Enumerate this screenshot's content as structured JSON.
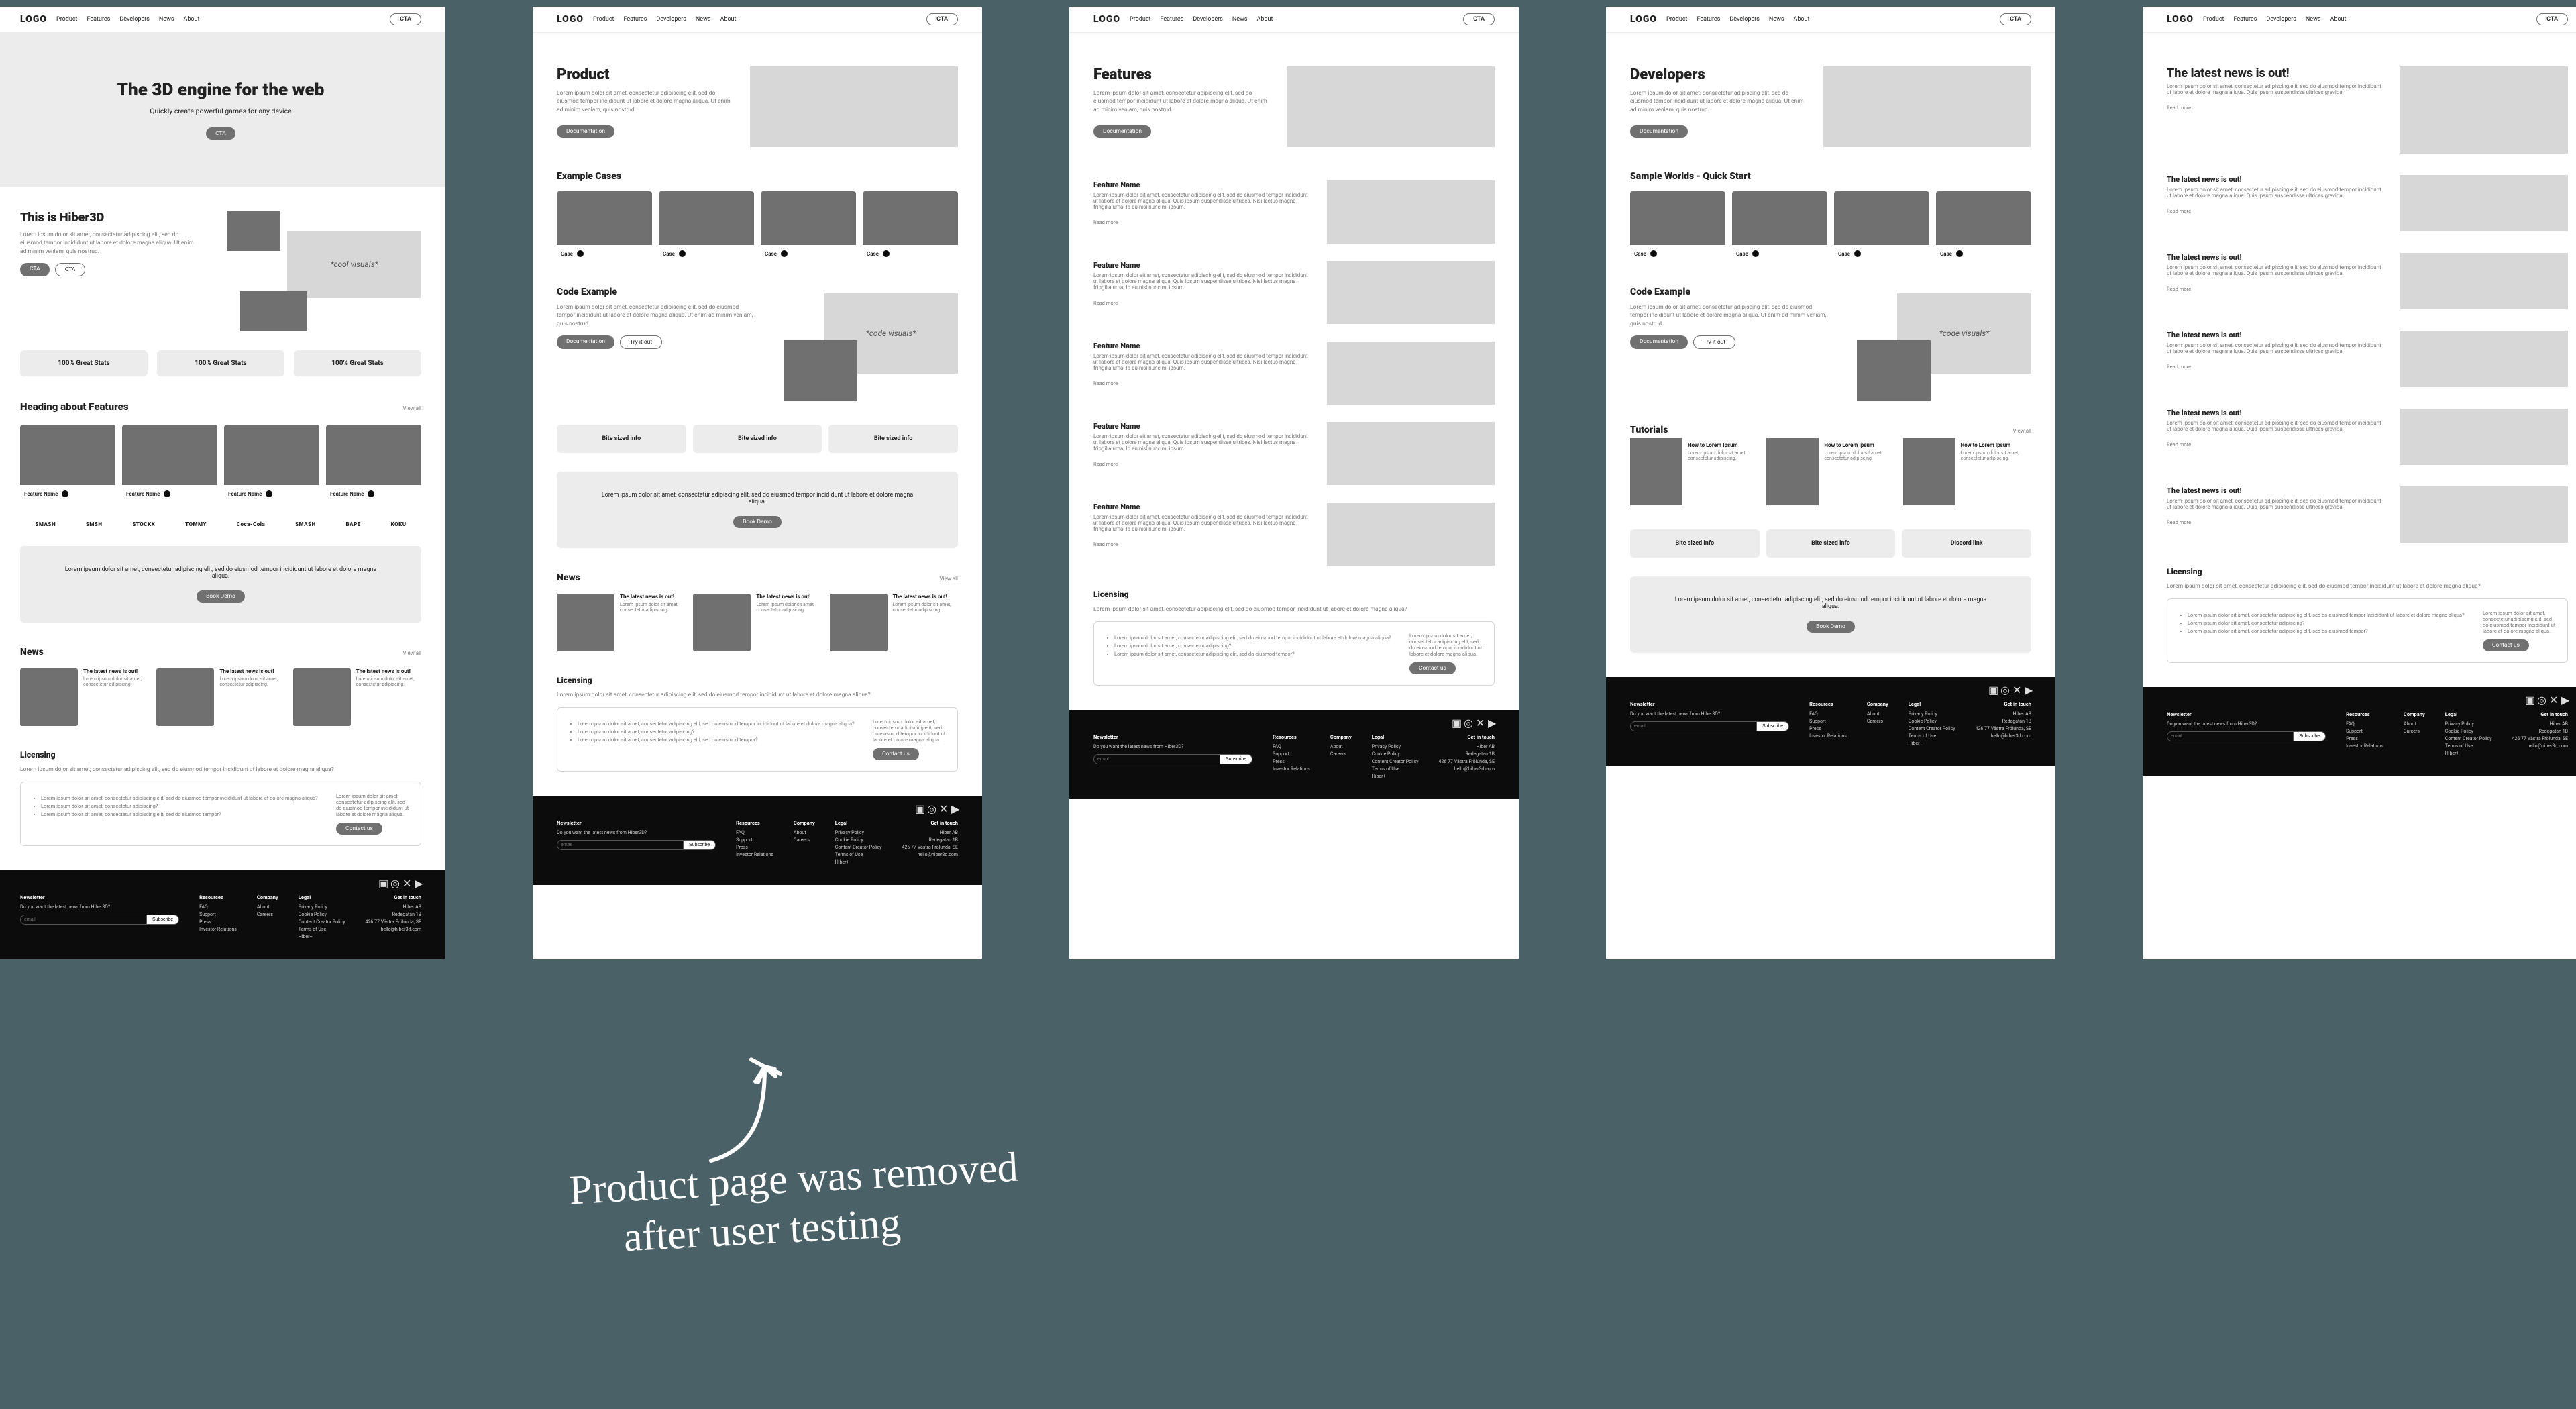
{
  "meta": {
    "domain": "Document"
  },
  "nav": {
    "logo": "LOGO",
    "items": [
      "Product",
      "Features",
      "Developers",
      "News",
      "About"
    ],
    "cta": "CTA"
  },
  "home": {
    "hero_title": "The 3D engine for the web",
    "hero_sub": "Quickly create powerful games for any device",
    "hero_cta": "CTA",
    "hiber_title": "This is Hiber3D",
    "hiber_copy": "Lorem ipsum dolor sit amet, consectetur adipiscing elit, sed do eiusmod tempor incididunt ut labore et dolore magna aliqua. Ut enim ad minim veniam, quis nostrud.",
    "hiber_cta1": "CTA",
    "hiber_cta2": "CTA",
    "hiber_visual": "*cool visuals*",
    "stats": [
      "100% Great Stats",
      "100% Great Stats",
      "100% Great Stats"
    ],
    "features_heading": "Heading about Features",
    "view_all": "View all",
    "feature_cards": [
      {
        "label": "Feature Name"
      },
      {
        "label": "Feature Name"
      },
      {
        "label": "Feature Name"
      },
      {
        "label": "Feature Name"
      }
    ],
    "partners": [
      "SMASH",
      "SMSH",
      "STOCKX",
      "TOMMY",
      "Coca-Cola",
      "SMASH",
      "BAPE",
      "KOKU"
    ],
    "banner_copy": "Lorem ipsum dolor sit amet, consectetur adipiscing elit, sed do eiusmod tempor incididunt ut labore et dolore magna aliqua.",
    "banner_cta": "Book Demo",
    "news_heading": "News",
    "news_items": [
      {
        "title": "The latest news is out!",
        "copy": "Lorem ipsum dolor sit amet, consectetur adipiscing."
      },
      {
        "title": "The latest news is out!",
        "copy": "Lorem ipsum dolor sit amet, consectetur adipiscing."
      },
      {
        "title": "The latest news is out!",
        "copy": "Lorem ipsum dolor sit amet, consectetur adipiscing."
      }
    ],
    "licensing_heading": "Licensing",
    "licensing_intro": "Lorem ipsum dolor sit amet, consectetur adipiscing elit, sed do eiusmod tempor incididunt ut labore et dolore magna aliqua?",
    "licensing_bullets": [
      "Lorem ipsum dolor sit amet, consectetur adipiscing elit, sed do eiusmod tempor incididunt ut labore et dolore magna aliqua?",
      "Lorem ipsum dolor sit amet, consectetur adipiscing?",
      "Lorem ipsum dolor sit amet, consectetur adipiscing elit, sed do eiusmod tempor?"
    ],
    "lic_right_copy": "Lorem ipsum dolor sit amet, consectetur adipiscing elit, sed do eiusmod tempor incididunt ut labore et dolore magna aliqua.",
    "contact_btn": "Contact us"
  },
  "product": {
    "title": "Product",
    "intro": "Lorem ipsum dolor sit amet, consectetur adipiscing elit, sed do eiusmod tempor incididunt ut labore et dolore magna aliqua. Ut enim ad minim veniam, quis nostrud.",
    "doc_btn": "Documentation",
    "examples_heading": "Example Cases",
    "case_label": "Case",
    "code_heading": "Code Example",
    "code_copy": "Lorem ipsum dolor sit amet, consectetur adipiscing elit, sed do eiusmod tempor incididunt ut labore et dolore magna aliqua. Ut enim ad minim veniam, quis nostrud.",
    "code_visual": "*code visuals*",
    "code_btn1": "Documentation",
    "code_btn2": "Try it out",
    "bites": [
      "Bite sized info",
      "Bite sized info",
      "Bite sized info"
    ],
    "book_demo": "Book Demo",
    "news_heading": "News",
    "licensing_heading": "Licensing",
    "view_all": "View all"
  },
  "features": {
    "title": "Features",
    "intro": "Lorem ipsum dolor sit amet, consectetur adipiscing elit, sed do eiusmod tempor incididunt ut labore et dolore magna aliqua. Ut enim ad minim veniam, quis nostrud.",
    "doc_btn": "Documentation",
    "items": [
      {
        "title": "Feature Name",
        "copy": "Lorem ipsum dolor sit amet, consectetur adipiscing elit, sed do eiusmod tempor incididunt ut labore et dolore magna aliqua. Quis ipsum suspendisse ultrices. Nisi lectus magna fringilla urna. Id eu nisl nunc mi ipsum.",
        "more": "Read more"
      },
      {
        "title": "Feature Name",
        "copy": "Lorem ipsum dolor sit amet, consectetur adipiscing elit, sed do eiusmod tempor incididunt ut labore et dolore magna aliqua. Quis ipsum suspendisse ultrices. Nisi lectus magna fringilla urna. Id eu nisl nunc mi ipsum.",
        "more": "Read more"
      },
      {
        "title": "Feature Name",
        "copy": "Lorem ipsum dolor sit amet, consectetur adipiscing elit, sed do eiusmod tempor incididunt ut labore et dolore magna aliqua. Quis ipsum suspendisse ultrices. Nisi lectus magna fringilla urna. Id eu nisl nunc mi ipsum.",
        "more": "Read more"
      },
      {
        "title": "Feature Name",
        "copy": "Lorem ipsum dolor sit amet, consectetur adipiscing elit, sed do eiusmod tempor incididunt ut labore et dolore magna aliqua. Quis ipsum suspendisse ultrices. Nisi lectus magna fringilla urna. Id eu nisl nunc mi ipsum.",
        "more": "Read more"
      },
      {
        "title": "Feature Name",
        "copy": "Lorem ipsum dolor sit amet, consectetur adipiscing elit, sed do eiusmod tempor incididunt ut labore et dolore magna aliqua. Quis ipsum suspendisse ultrices. Nisi lectus magna fringilla urna. Id eu nisl nunc mi ipsum.",
        "more": "Read more"
      }
    ],
    "licensing_heading": "Licensing"
  },
  "developers": {
    "title": "Developers",
    "intro": "Lorem ipsum dolor sit amet, consectetur adipiscing elit, sed do eiusmod tempor incididunt ut labore et dolore magna aliqua. Ut enim ad minim veniam, quis nostrud.",
    "doc_btn": "Documentation",
    "worlds_heading": "Sample Worlds - Quick Start",
    "case_label": "Case",
    "code_heading": "Code Example",
    "code_visual": "*code visuals*",
    "code_btn1": "Documentation",
    "code_btn2": "Try it out",
    "tutorials_heading": "Tutorials",
    "view_all": "View all",
    "tutorials": [
      {
        "title": "How to Lorem Ipsum",
        "copy": "Lorem ipsum dolor sit amet, consectetur adipiscing."
      },
      {
        "title": "How to Lorem Ipsum",
        "copy": "Lorem ipsum dolor sit amet, consectetur adipiscing."
      },
      {
        "title": "How to Lorem Ipsum",
        "copy": "Lorem ipsum dolor sit amet, consectetur adipiscing."
      }
    ],
    "bites": [
      "Bite sized info",
      "Bite sized info",
      "Discord link"
    ],
    "book_demo": "Book Demo"
  },
  "newspage": {
    "items": [
      {
        "title": "The latest news is out!",
        "copy": "Lorem ipsum dolor sit amet, consectetur adipiscing elit, sed do eiusmod tempor incididunt ut labore et dolore magna aliqua. Quis ipsum suspendisse ultrices gravida.",
        "more": "Read more"
      },
      {
        "title": "The latest news is out!",
        "copy": "Lorem ipsum dolor sit amet, consectetur adipiscing elit, sed do eiusmod tempor incididunt ut labore et dolore magna aliqua. Quis ipsum suspendisse ultrices gravida.",
        "more": "Read more"
      },
      {
        "title": "The latest news is out!",
        "copy": "Lorem ipsum dolor sit amet, consectetur adipiscing elit, sed do eiusmod tempor incididunt ut labore et dolore magna aliqua. Quis ipsum suspendisse ultrices gravida.",
        "more": "Read more"
      },
      {
        "title": "The latest news is out!",
        "copy": "Lorem ipsum dolor sit amet, consectetur adipiscing elit, sed do eiusmod tempor incididunt ut labore et dolore magna aliqua. Quis ipsum suspendisse ultrices gravida.",
        "more": "Read more"
      },
      {
        "title": "The latest news is out!",
        "copy": "Lorem ipsum dolor sit amet, consectetur adipiscing elit, sed do eiusmod tempor incididunt ut labore et dolore magna aliqua. Quis ipsum suspendisse ultrices gravida.",
        "more": "Read more"
      },
      {
        "title": "The latest news is out!",
        "copy": "Lorem ipsum dolor sit amet, consectetur adipiscing elit, sed do eiusmod tempor incididunt ut labore et dolore magna aliqua. Quis ipsum suspendisse ultrices gravida.",
        "more": "Read more"
      }
    ],
    "licensing_heading": "Licensing"
  },
  "footer": {
    "newsletter_heading": "Newsletter",
    "newsletter_copy": "Do you want the latest news from Hiber3D?",
    "placeholder": "email",
    "subscribe": "Subscribe",
    "cols": {
      "resources": {
        "heading": "Resources",
        "links": [
          "FAQ",
          "Support",
          "Press",
          "Investor Relations"
        ]
      },
      "company": {
        "heading": "Company",
        "links": [
          "About",
          "Careers"
        ]
      },
      "legal": {
        "heading": "Legal",
        "links": [
          "Privacy Policy",
          "Cookie Policy",
          "Content Creator Policy",
          "Terms of Use",
          "Hiber+"
        ]
      },
      "contact": {
        "heading": "Get in touch",
        "lines": [
          "Hiber AB",
          "Redegatan 1B",
          "426 77 Västra Frölunda, SE"
        ],
        "email": "hello@hiber3d.com"
      }
    }
  },
  "annotation": "Product page was removed\n     after user testing"
}
